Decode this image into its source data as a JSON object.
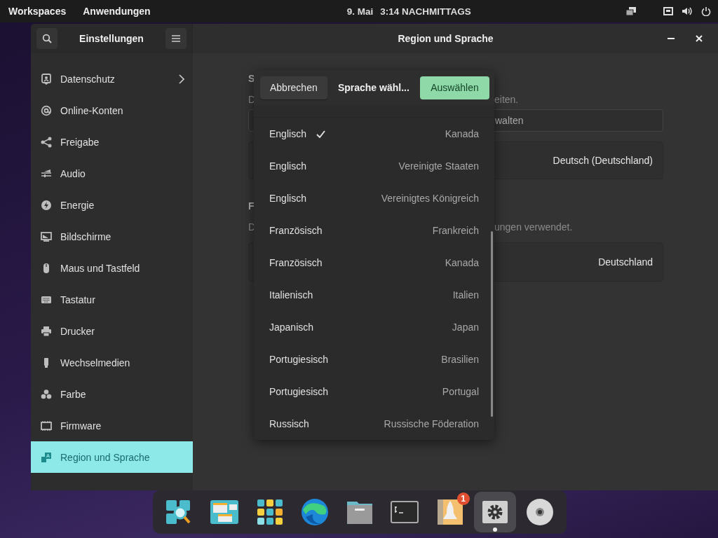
{
  "top_bar": {
    "workspaces": "Workspaces",
    "applications": "Anwendungen",
    "date": "9. Mai",
    "time": "3:14 NACHMITTAGS"
  },
  "window": {
    "sidebar_title": "Einstellungen",
    "title": "Region und Sprache"
  },
  "sidebar": {
    "items": [
      {
        "label": "Datenschutz",
        "selected": false,
        "chevron": true
      },
      {
        "label": "Online-Konten",
        "selected": false,
        "chevron": false
      },
      {
        "label": "Freigabe",
        "selected": false,
        "chevron": false
      },
      {
        "label": "Audio",
        "selected": false,
        "chevron": false
      },
      {
        "label": "Energie",
        "selected": false,
        "chevron": false
      },
      {
        "label": "Bildschirme",
        "selected": false,
        "chevron": false
      },
      {
        "label": "Maus und Tastfeld",
        "selected": false,
        "chevron": false
      },
      {
        "label": "Tastatur",
        "selected": false,
        "chevron": false
      },
      {
        "label": "Drucker",
        "selected": false,
        "chevron": false
      },
      {
        "label": "Wechselmedien",
        "selected": false,
        "chevron": false
      },
      {
        "label": "Farbe",
        "selected": false,
        "chevron": false
      },
      {
        "label": "Firmware",
        "selected": false,
        "chevron": false
      },
      {
        "label": "Region und Sprache",
        "selected": true,
        "chevron": false
      }
    ]
  },
  "content": {
    "sections": [
      {
        "heading": "S",
        "description_start": "D",
        "description_end": "eiten.",
        "field_end": "walten",
        "value": "Deutsch (Deutschland)"
      },
      {
        "heading": "F",
        "description_start": "D",
        "description_end": "ungen verwendet.",
        "value": "Deutschland"
      }
    ]
  },
  "popover": {
    "cancel": "Abbrechen",
    "title": "Sprache wähl...",
    "confirm": "Auswählen",
    "rows": [
      {
        "language": "Englisch",
        "region": "Kanada",
        "selected": true
      },
      {
        "language": "Englisch",
        "region": "Vereinigte Staaten",
        "selected": false
      },
      {
        "language": "Englisch",
        "region": "Vereinigtes Königreich",
        "selected": false
      },
      {
        "language": "Französisch",
        "region": "Frankreich",
        "selected": false
      },
      {
        "language": "Französisch",
        "region": "Kanada",
        "selected": false
      },
      {
        "language": "Italienisch",
        "region": "Italien",
        "selected": false
      },
      {
        "language": "Japanisch",
        "region": "Japan",
        "selected": false
      },
      {
        "language": "Portugiesisch",
        "region": "Brasilien",
        "selected": false
      },
      {
        "language": "Portugiesisch",
        "region": "Portugal",
        "selected": false
      },
      {
        "language": "Russisch",
        "region": "Russische Föderation",
        "selected": false
      }
    ]
  },
  "dock": {
    "items": [
      {
        "running": false
      },
      {
        "running": false
      },
      {
        "running": false
      },
      {
        "running": false
      },
      {
        "running": false
      },
      {
        "running": false
      },
      {
        "running": false,
        "badge": "1"
      },
      {
        "running": true
      },
      {
        "running": false
      }
    ]
  }
}
